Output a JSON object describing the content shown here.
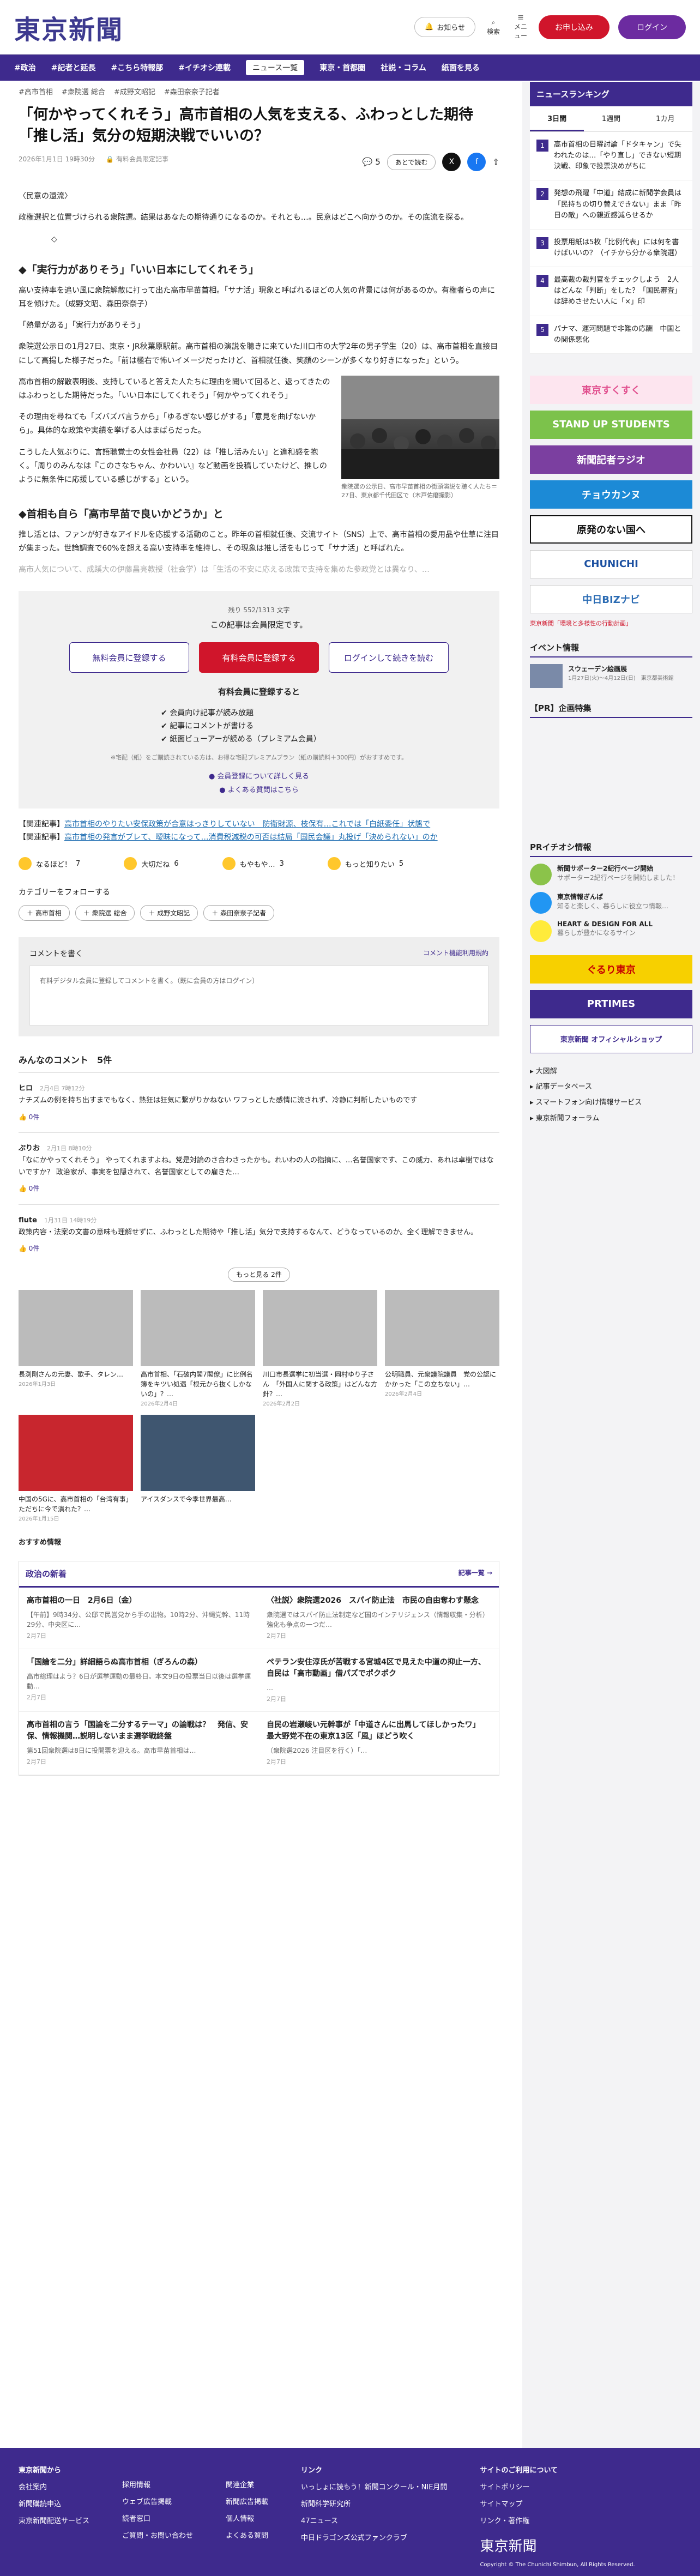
{
  "header": {
    "logo": "東京新聞",
    "notice": "お知らせ",
    "search": "検索",
    "menu": "メニュー",
    "subscribe": "お申し込み",
    "login": "ログイン"
  },
  "nav": {
    "items": [
      "#政治",
      "#記者と延長",
      "#こちら特報部",
      "#イチオシ連載"
    ],
    "dropdowns": [
      "ニュース一覧",
      "東京・首都圏",
      "社説・コラム",
      "紙面を見る"
    ]
  },
  "article": {
    "tags": [
      "#高市首相",
      "#衆院選 総合",
      "#成野文昭記",
      "#森田奈奈子記者"
    ],
    "title": "「何かやってくれそう」高市首相の人気を支える、ふわっとした期待 「推し活」気分の短期決戦でいいの？",
    "date": "2026年1月1日 19時30分",
    "member_badge": "有料会員限定記事",
    "comment_count": "5",
    "save": "あとで読む",
    "series": "〈民意の還流〉",
    "lead": "政権選択と位置づけられる衆院選。結果はあなたの期待通りになるのか。それとも…。民意はどこへ向かうのか。その底流を探る。",
    "star": "◇",
    "h1": "◆「実行力がありそう」「いい日本にしてくれそう」",
    "p1": "高い支持率を追い風に衆院解散に打って出た高市早苗首相。「サナ活」現象と呼ばれるほどの人気の背景には何があるのか。有権者らの声に耳を傾けた。（成野文昭、森田奈奈子）",
    "p2": "「熱量がある」「実行力がありそう」",
    "p3": "衆院選公示日の1月27日、東京・JR秋葉原駅前。高市首相の演説を聴きに来ていた川口市の大学2年の男子学生（20）は、高市首相を直接目にして高揚した様子だった。「前は極右で怖いイメージだったけど、首相就任後、笑顔のシーンが多くなり好きになった」という。",
    "p4": "高市首相の解散表明後、支持していると答えた人たちに理由を聞いて回ると、返ってきたのはふわっとした期待だった。「いい日本にしてくれそう」「何かやってくれそう」",
    "p5": "その理由を尋ねても「ズバズバ言うから」「ゆるぎない感じがする」「意見を曲げないから」。具体的な政策や実績を挙げる人はまばらだった。",
    "p6": "こうした人気ぶりに、言語聴覚士の女性会社員（22）は「推し活みたい」と違和感を抱く。「周りのみんなは『このさなちゃん、かわいい』など動画を投稿していたけど、推しのように無条件に応援している感じがする」という。",
    "h2": "◆首相も自ら「高市早苗で良いかどうか」と",
    "p7": "推し活とは、ファンが好きなアイドルを応援する活動のこと。昨年の首相就任後、交流サイト（SNS）上で、高市首相の愛用品や仕草に注目が集まった。世論調査で60%を超える高い支持率を維持し、その現象は推し活をもじって「サナ活」と呼ばれた。",
    "p8": "高市人気について、成蹊大の伊藤昌亮教授（社会学）は「生活の不安に応える政策で支持を集めた参政党とは異なり、…",
    "photo_caption": "衆院選の公示日、高市早苗首相の街頭演説を聴く人たち＝27日、東京都千代田区で（木戸佑磨撮影）"
  },
  "paywall": {
    "remain": "残り 552/1313 文字",
    "title": "この記事は会員限定です。",
    "btn_free": "無料会員に登録する",
    "btn_paid": "有料会員に登録する",
    "btn_login": "ログインして続きを読む",
    "benefit_title": "有料会員に登録すると",
    "benefits": [
      "会員向け記事が読み放題",
      "記事にコメントが書ける",
      "紙面ビューアーが読める（プレミアム会員）"
    ],
    "note": "※宅配（紙）をご購読されている方は、お得な宅配プレミアムプラン（紙の購読料＋300円）がおすすめです。",
    "link1": "会員登録について詳しく見る",
    "link2": "よくある質問はこちら"
  },
  "related": {
    "label": "【関連記事】",
    "r1": "高市首相のやりたい安保政策が合意はっきりしていない　防衛財源、枝保有…これでは「白紙委任」状態で",
    "r2": "高市首相の発言がブレて、曖昧になって…消費税減税の可否は結局「国民会議」丸投げ「決められない」のか"
  },
  "reactions": [
    {
      "l": "なるほど！",
      "c": "7"
    },
    {
      "l": "大切だね",
      "c": "6"
    },
    {
      "l": "もやもや…",
      "c": "3"
    },
    {
      "l": "もっと知りたい",
      "c": "5"
    }
  ],
  "follow": {
    "title": "カテゴリーをフォローする",
    "chips": [
      "＋ 高市首相",
      "＋ 衆院選 総合",
      "＋ 成野文昭記",
      "＋ 森田奈奈子記者"
    ]
  },
  "comment_form": {
    "title": "コメントを書く",
    "policy": "コメント機能利用規約",
    "prompt": "有料デジタル会員に登録してコメントを書く。（既に会員の方はログイン）"
  },
  "comments": {
    "title": "みんなのコメント",
    "count": "5件",
    "items": [
      {
        "name": "ヒロ",
        "date": "2月4日 7時12分",
        "text": "ナチズムの例を持ち出すまでもなく、熱狂は狂気に繋がりかねない ワフっとした感情に流されず、冷静に判断したいものです",
        "good": "0件"
      },
      {
        "name": "ぷりお",
        "date": "2月1日 8時10分",
        "text": "「なにかやってくれそう」 やってくれますよね。党是対論のさ合わさったかも。れいわの人の指摘に、…名誉国家です、この威力、あれは卓樹ではないですか？ 政治家が、事実を包隠されて、名誉国家としての雇きた…",
        "good": "0件"
      },
      {
        "name": "flute",
        "date": "1月31日 14時19分",
        "text": "政策内容・法案の文書の意味も理解せずに、ふわっとした期待や「推し活」気分で支持するなんて、どうなっているのか。全く理解できません。",
        "good": "0件"
      }
    ],
    "more": "もっと見る 2件"
  },
  "news": [
    {
      "t": "長渕剛さんの元妻、歌手、タレン…",
      "d": "2026年1月3日"
    },
    {
      "t": "高市首相、「石破内閣7閣僚」に比例名簿をキツい処遇「根元から抜くしかないの」？…",
      "d": "2026年2月4日"
    },
    {
      "t": "川口市長選挙に初当選・岡村ゆり子さん　「外国人に関する政策」はどんな方針？…",
      "d": "2026年2月2日"
    },
    {
      "t": "公明職員、元衆議院議員　党の公認にかかった「この立ちない」…",
      "d": "2026年2月4日"
    },
    {
      "t": "中国の5Gに、高市首相の「台湾有事」ただちに今で潰れた？…",
      "d": "2026年1月15日"
    },
    {
      "t": "アイスダンスで今季世界最高…"
    }
  ],
  "recommend": "おすすめ情報",
  "politics": {
    "title": "政治の新着",
    "more": "記事一覧 →",
    "items": [
      {
        "t": "高市首相の一日　2月6日（金）",
        "s": "【午前】9時34分、公邸で民営党から手の出物。10時2分、沖縄党幹、11時29分、中央区に…",
        "d": "2月7日"
      },
      {
        "t": "〈社説〉衆院選2026　スパイ防止法　市民の自由奪わす懸念",
        "s": "衆院選ではスパイ防止法制定など国のインテリジェンス（情報収集・分析）強化も争点の一つだ…",
        "d": "2月7日"
      },
      {
        "t": "「国論を二分」詳細語らぬ高市首相（ぎろんの森）",
        "s": "高市総理はよう？6日が選挙運動の最終日。本文9日の投票当日以後は選挙運動…",
        "d": "2月7日"
      },
      {
        "t": "ペテラン安住淳氏が苦戦する宮城4区で見えた中道の抑止一方、自民は「高市動画」借パズでポクポク",
        "s": "…",
        "d": "2月7日"
      },
      {
        "t": "高市首相の言う「国論を二分するテーマ」の論戦は？　発信、安保、情報機関…説明しないまま選挙戦終盤",
        "s": "第51回衆院選は8日に投開票を迎える。高市早苗首相は…",
        "d": "2月7日"
      },
      {
        "t": "自民の岩瀬崚い元幹事が「中道さんに出馬してほしかったワ」　最大野党不在の東京13区「風」ほどう吹く",
        "s": "（衆院選2026 注目区を行く）「…",
        "d": "2月7日"
      }
    ]
  },
  "sidebar": {
    "ranking_title": "ニュースランキング",
    "tabs": [
      "3日間",
      "1週間",
      "1カ月"
    ],
    "ranking": [
      "高市首相の日曜討論「ドタキャン」で失われたのは…「やり直し」できない短期決戦、印象で投票決めがちに",
      "発想の飛躍「中道」結成に新聞学会員は「民持ちの切り替えできない」まま「昨日の敵」への親近感減らせるか",
      "投票用紙は5枚「比例代表」には何を書けばいいの？（イチから分かる衆院選）",
      "最高裁の裁判官をチェックしよう　2人はどんな「判断」をした？「国民審査」は辞めさせたい人に「×」印",
      "パナマ、運河問題で非難の応酬　中国との関係悪化"
    ],
    "banners": [
      "東京すくすく",
      "STAND UP STUDENTS",
      "新聞記者ラジオ",
      "チョウカンヌ",
      "原発のない国へ",
      "CHUNICHI",
      "中日BIZナビ",
      "東京新聞「環境と多様性の行動計画」"
    ],
    "event_title": "イベント情報",
    "event": {
      "t": "スウェーデン絵画展",
      "s": "1月27日(火)〜4月12日(日)　東京都美術館"
    },
    "pr": "【PR】企画特集",
    "pr_title": "PRイチオシ情報",
    "pr_items": [
      {
        "t": "新聞サポーター2紀行ページ開始",
        "s": "サポーター2紀行ページを開始しました！"
      },
      {
        "t": "東京情報ぎんぱ",
        "s": "知ると楽しく、暮らしに役立つ情報…"
      },
      {
        "t": "HEART & DESIGN FOR ALL",
        "s": "暮らしが豊かになるサイン"
      }
    ],
    "links": [
      "大図解",
      "記事データベース",
      "スマートフォン向け情報サービス",
      "東京新聞フォーラム"
    ],
    "shop": "東京新聞 オフィシャルショップ"
  },
  "footer": {
    "col1_title": "東京新聞から",
    "col1": [
      "会社案内",
      "新聞購読申込",
      "東京新聞配送サービス"
    ],
    "col2": [
      "採用情報",
      "ウェブ広告掲載",
      "読者窓口",
      "ご質問・お問い合わせ"
    ],
    "col3": [
      "関連企業",
      "新聞広告掲載",
      "個人情報",
      "よくある質問"
    ],
    "col2_title": "リンク",
    "links": [
      "いっしょに読もう！新聞コンクール・NIE月間",
      "新聞科学研究所",
      "47ニュース",
      "中日ドラゴンズ公式ファンクラブ"
    ],
    "col3_title": "サイトのご利用について",
    "site": [
      "サイトポリシー",
      "サイトマップ",
      "リンク・著作権"
    ],
    "copyright": "Copyright © The Chunichi Shimbun, All Rights Reserved."
  }
}
